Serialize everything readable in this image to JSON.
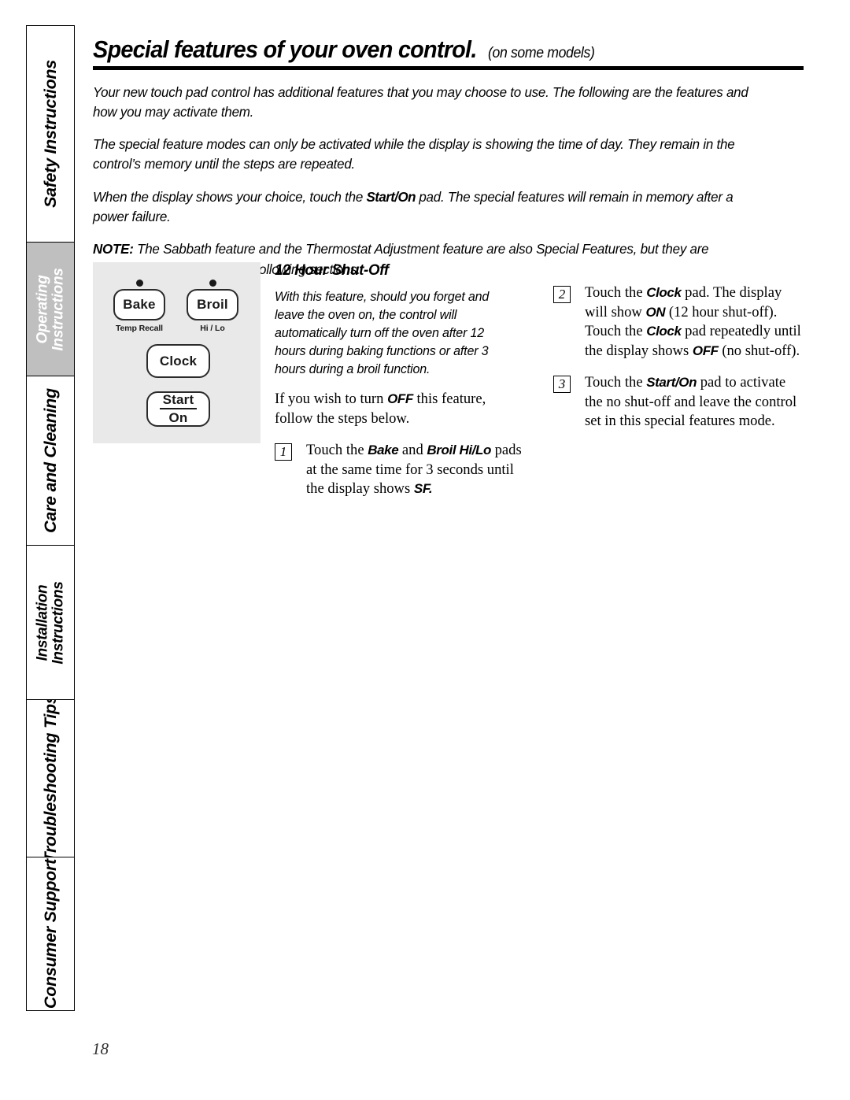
{
  "sidebar": {
    "tabs": [
      {
        "id": "safety",
        "label": "Safety Instructions",
        "active": false,
        "lines": [
          "Safety Instructions"
        ]
      },
      {
        "id": "operating",
        "label": "Operating Instructions",
        "active": true,
        "lines": [
          "Operating",
          "Instructions"
        ]
      },
      {
        "id": "care",
        "label": "Care and Cleaning",
        "active": false,
        "lines": [
          "Care and Cleaning"
        ]
      },
      {
        "id": "installation",
        "label": "Installation Instructions",
        "active": false,
        "lines": [
          "Installation",
          "Instructions"
        ]
      },
      {
        "id": "trouble",
        "label": "Troubleshooting Tips",
        "active": false,
        "lines": [
          "Troubleshooting Tips"
        ]
      },
      {
        "id": "consumer",
        "label": "Consumer Support",
        "active": false,
        "lines": [
          "Consumer Support"
        ]
      }
    ],
    "active_color": "#bfbfbf",
    "active_text_color": "#ffffff"
  },
  "header": {
    "title": "Special features of your oven control.",
    "subtitle": "(on some models)"
  },
  "intro": {
    "p1": "Your new touch pad control has additional features that you may choose to use. The following are the features and how you may activate them.",
    "p2": "The special feature modes can only be activated while the display is showing the time of day. They remain in the control’s memory until the steps are repeated.",
    "p3_a": "When the display shows your choice, touch the ",
    "p3_bold": "Start/On",
    "p3_b": " pad. The special features will remain in memory after a power failure.",
    "note_label": "NOTE:",
    "note_text": " The Sabbath feature and the Thermostat Adjustment feature are also Special Features, but they are addressed separately in the following sections."
  },
  "control_panel": {
    "background_color": "#e9e9e9",
    "pads": [
      {
        "id": "bake",
        "label": "Bake",
        "sub_label": "Temp Recall",
        "has_led": true
      },
      {
        "id": "broil",
        "label": "Broil",
        "sub_label": "Hi / Lo",
        "has_led": true
      },
      {
        "id": "clock",
        "label": "Clock",
        "sub_label": "",
        "has_led": false
      },
      {
        "id": "start",
        "label_line1": "Start",
        "label_line2": "On",
        "has_led": false
      }
    ]
  },
  "section": {
    "heading": "12 Hour Shut-Off",
    "description": "With this feature, should you forget and leave the oven on, the control will automatically turn off the oven after 12 hours during baking functions or after 3 hours during a broil function.",
    "lead_a": "If you wish to turn ",
    "lead_bold": "OFF",
    "lead_b": " this feature, follow the steps below.",
    "steps": [
      {
        "number": "1",
        "frag": [
          {
            "t": "Touch the ",
            "b": false
          },
          {
            "t": "Bake",
            "b": true
          },
          {
            "t": " and ",
            "b": false
          },
          {
            "t": "Broil Hi/Lo",
            "b": true
          },
          {
            "t": " pads at the same time for 3 seconds until the display shows ",
            "b": false
          },
          {
            "t": "SF.",
            "b": true
          }
        ]
      },
      {
        "number": "2",
        "frag": [
          {
            "t": "Touch the ",
            "b": false
          },
          {
            "t": "Clock",
            "b": true
          },
          {
            "t": " pad. The display will show ",
            "b": false
          },
          {
            "t": "ON",
            "b": true
          },
          {
            "t": " (12 hour shut-off). Touch the ",
            "b": false
          },
          {
            "t": "Clock",
            "b": true
          },
          {
            "t": " pad repeatedly until the display shows ",
            "b": false
          },
          {
            "t": "OFF",
            "b": true
          },
          {
            "t": " (no shut-off).",
            "b": false
          }
        ]
      },
      {
        "number": "3",
        "frag": [
          {
            "t": "Touch the ",
            "b": false
          },
          {
            "t": "Start/On",
            "b": true
          },
          {
            "t": " pad to activate the no shut-off and leave the control set in this special features mode.",
            "b": false
          }
        ]
      }
    ]
  },
  "footer": {
    "page_number": "18"
  }
}
